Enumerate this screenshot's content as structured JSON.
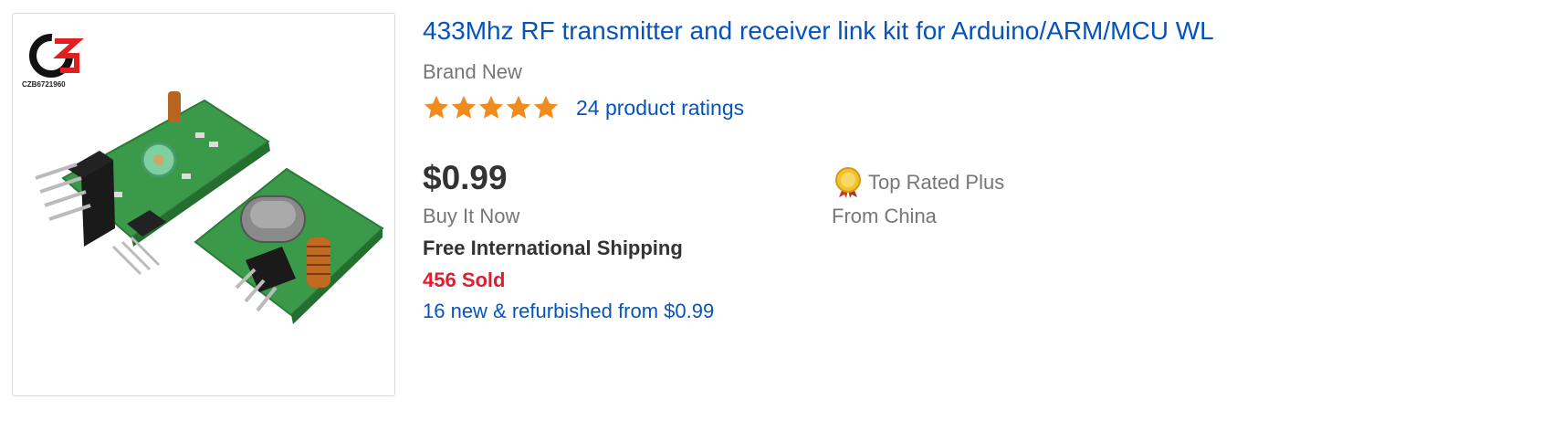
{
  "listing": {
    "image_watermark": "CZB6721960",
    "title": "433Mhz RF transmitter and receiver link kit for Arduino/ARM/MCU WL",
    "condition": "Brand New",
    "rating": {
      "stars": 5,
      "max_stars": 5,
      "ratings_text": "24 product ratings"
    },
    "price": "$0.99",
    "format": "Buy It Now",
    "shipping": "Free International Shipping",
    "sold": "456 Sold",
    "alternatives": "16 new & refurbished from $0.99",
    "badge": {
      "label": "Top Rated Plus",
      "icon": "top-rated-medal-icon"
    },
    "origin": "From China"
  },
  "colors": {
    "link": "#0654ba",
    "sold": "#dd1e31",
    "star": "#f18c1c",
    "pcb": "#3a9a4a"
  }
}
